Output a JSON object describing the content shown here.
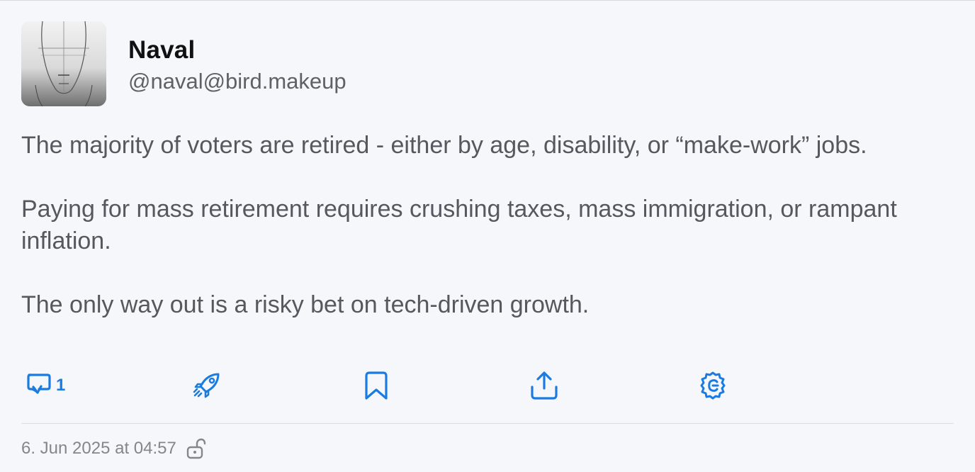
{
  "author": {
    "display_name": "Naval",
    "handle": "@naval@bird.makeup"
  },
  "post": {
    "paragraphs": [
      "The majority of voters are retired - either by age, disability, or “make-work” jobs.",
      "Paying for mass retirement requires crushing taxes, mass immigration, or rampant inflation.",
      "The only way out is a risky bet on tech-driven growth."
    ]
  },
  "actions": {
    "reply_count": "1",
    "icons": [
      "reply-icon",
      "boost-icon",
      "bookmark-icon",
      "share-icon",
      "settings-icon"
    ]
  },
  "meta": {
    "timestamp": "6. Jun 2025 at 04:57",
    "visibility_icon": "unlocked-icon"
  },
  "colors": {
    "accent": "#1a7be0",
    "text": "#55585e",
    "muted": "#84868c",
    "background": "#f6f7fb"
  }
}
